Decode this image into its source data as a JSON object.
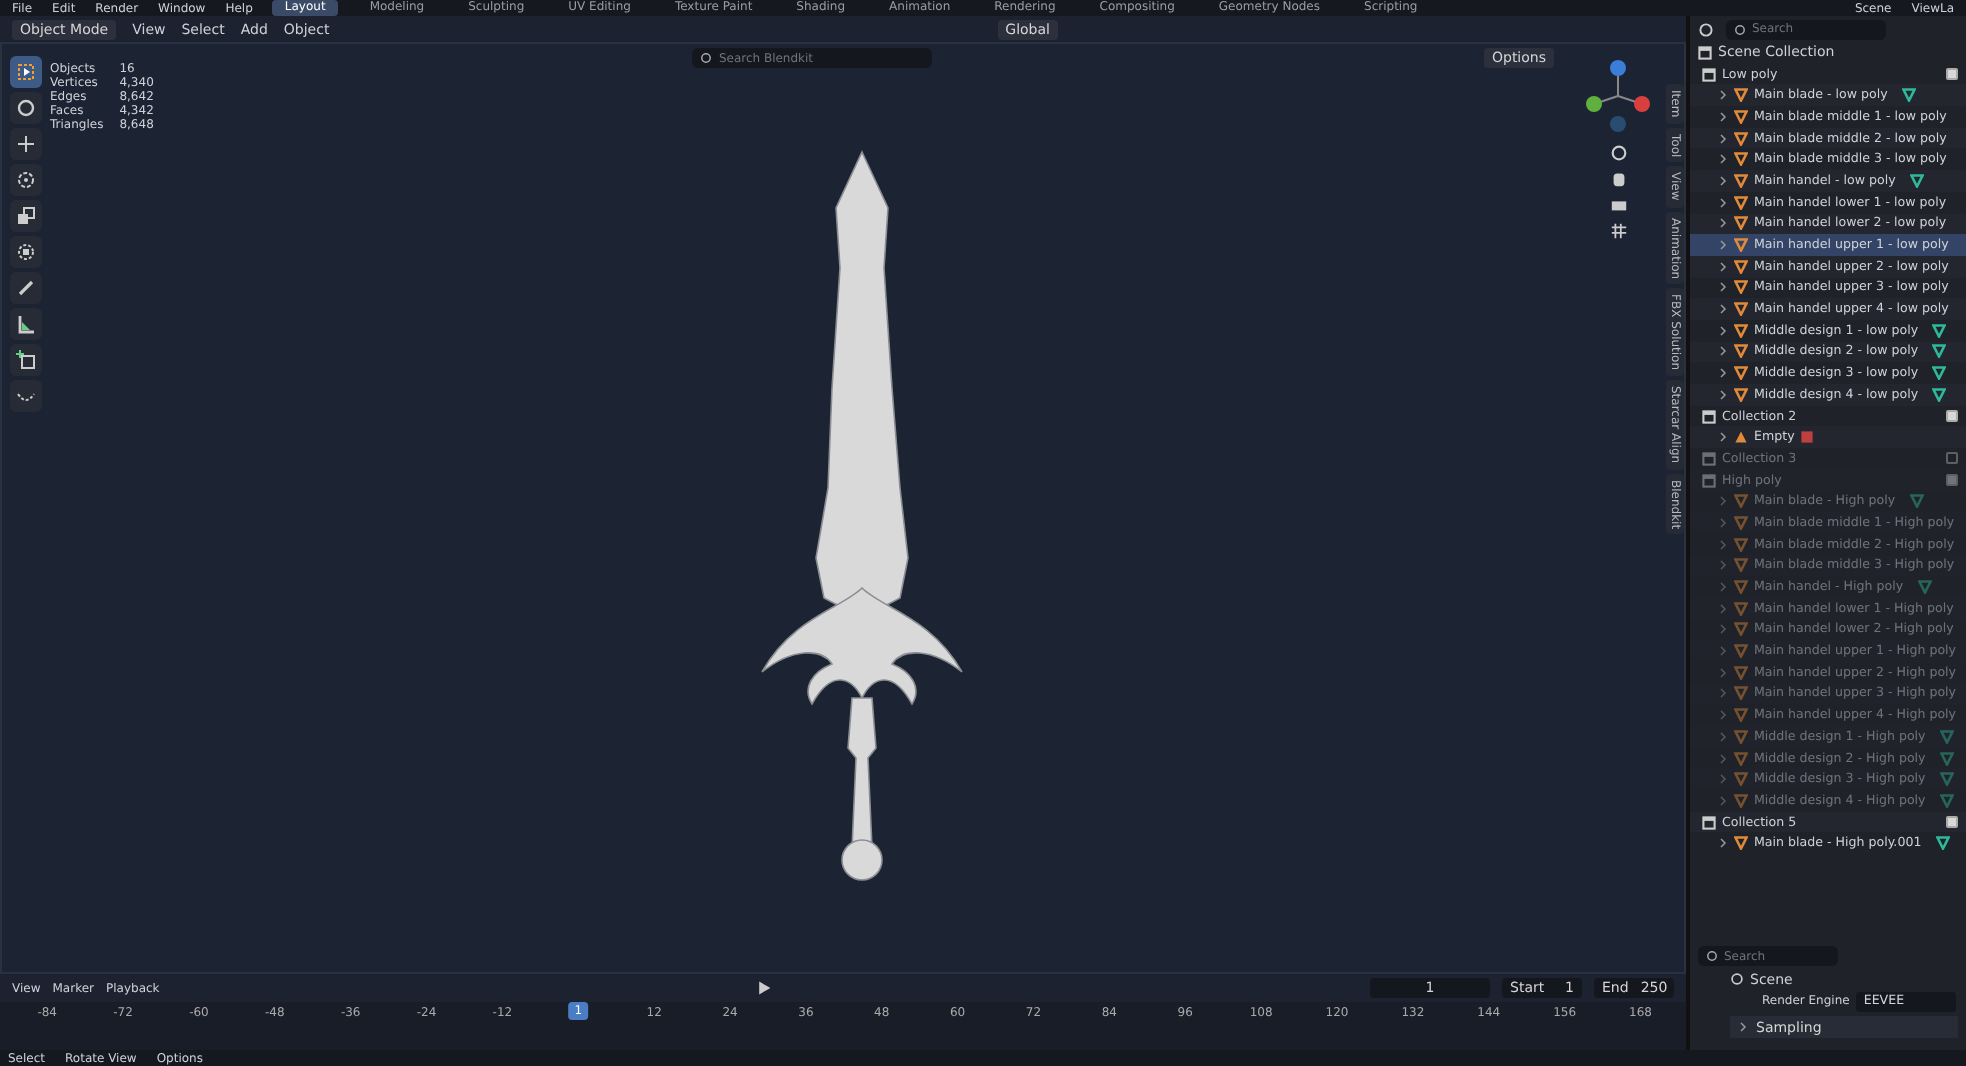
{
  "menu": [
    "File",
    "Edit",
    "Render",
    "Window",
    "Help"
  ],
  "workspaces": [
    {
      "label": "Layout",
      "selected": true
    },
    {
      "label": "Modeling",
      "selected": false
    },
    {
      "label": "Sculpting",
      "selected": false
    },
    {
      "label": "UV Editing",
      "selected": false
    },
    {
      "label": "Texture Paint",
      "selected": false
    },
    {
      "label": "Shading",
      "selected": false
    },
    {
      "label": "Animation",
      "selected": false
    },
    {
      "label": "Rendering",
      "selected": false
    },
    {
      "label": "Compositing",
      "selected": false
    },
    {
      "label": "Geometry Nodes",
      "selected": false
    },
    {
      "label": "Scripting",
      "selected": false
    }
  ],
  "scene": "Scene",
  "view_layer": "ViewLa",
  "header": {
    "mode": "Object Mode",
    "menus": [
      "View",
      "Select",
      "Add",
      "Object"
    ],
    "orientation": "Global"
  },
  "addon_search": {
    "placeholder": "Search Blendkit"
  },
  "options": "Options",
  "stats": [
    {
      "label": "Objects",
      "value": "16"
    },
    {
      "label": "Vertices",
      "value": "4,340"
    },
    {
      "label": "Edges",
      "value": "8,642"
    },
    {
      "label": "Faces",
      "value": "4,342"
    },
    {
      "label": "Triangles",
      "value": "8,648"
    }
  ],
  "tools": [
    {
      "kind": "select",
      "selected": true
    },
    {
      "kind": "cursor",
      "selected": false
    },
    {
      "kind": "move",
      "selected": false
    },
    {
      "kind": "rotate",
      "selected": false
    },
    {
      "kind": "scale",
      "selected": false
    },
    {
      "kind": "transform",
      "selected": false
    },
    {
      "kind": "annotate",
      "selected": false
    },
    {
      "kind": "measure",
      "selected": false
    },
    {
      "kind": "add",
      "selected": false
    },
    {
      "kind": "curve",
      "selected": false
    }
  ],
  "side_tabs": [
    "Item",
    "Tool",
    "View",
    "Animation",
    "FBX Solution",
    "Starcar Align",
    "Blendkit"
  ],
  "outliner": {
    "search": {
      "placeholder": "Search"
    },
    "root": "Scene Collection",
    "collections": [
      {
        "name": "Low poly",
        "dimmed": false,
        "checked": true,
        "children": [
          {
            "name": "Main blade - low poly",
            "kind": "mesh",
            "modifier": true,
            "active": false
          },
          {
            "name": "Main blade middle 1 - low poly",
            "kind": "mesh",
            "modifier": false,
            "active": false
          },
          {
            "name": "Main blade middle 2 - low poly",
            "kind": "mesh",
            "modifier": false,
            "active": false
          },
          {
            "name": "Main blade middle 3 - low poly",
            "kind": "mesh",
            "modifier": false,
            "active": false
          },
          {
            "name": "Main handel - low poly",
            "kind": "mesh",
            "modifier": true,
            "active": false
          },
          {
            "name": "Main handel lower 1 - low poly",
            "kind": "mesh",
            "modifier": false,
            "active": false
          },
          {
            "name": "Main handel lower 2 - low poly",
            "kind": "mesh",
            "modifier": false,
            "active": false
          },
          {
            "name": "Main handel upper 1 - low poly",
            "kind": "mesh",
            "modifier": false,
            "active": true
          },
          {
            "name": "Main handel upper 2 - low poly",
            "kind": "mesh",
            "modifier": false,
            "active": false
          },
          {
            "name": "Main handel upper 3 - low poly",
            "kind": "mesh",
            "modifier": false,
            "active": false
          },
          {
            "name": "Main handel upper 4 - low poly",
            "kind": "mesh",
            "modifier": false,
            "active": false
          },
          {
            "name": "Middle design 1 - low poly",
            "kind": "mesh",
            "modifier": true,
            "active": false
          },
          {
            "name": "Middle design 2 - low poly",
            "kind": "mesh",
            "modifier": true,
            "active": false
          },
          {
            "name": "Middle design 3 - low poly",
            "kind": "mesh",
            "modifier": true,
            "active": false
          },
          {
            "name": "Middle design 4 - low poly",
            "kind": "mesh",
            "modifier": true,
            "active": false
          }
        ]
      },
      {
        "name": "Collection 2",
        "dimmed": false,
        "checked": true,
        "children": [
          {
            "name": "Empty",
            "kind": "empty",
            "modifier": true,
            "active": false
          }
        ]
      },
      {
        "name": "Collection 3",
        "dimmed": true,
        "checked": false
      },
      {
        "name": "High poly",
        "dimmed": true,
        "checked": true,
        "children": [
          {
            "name": "Main blade - High poly",
            "kind": "mesh",
            "modifier": true,
            "active": false
          },
          {
            "name": "Main blade middle 1 - High poly",
            "kind": "mesh",
            "modifier": false,
            "active": false
          },
          {
            "name": "Main blade middle 2 - High poly",
            "kind": "mesh",
            "modifier": false,
            "active": false
          },
          {
            "name": "Main blade middle 3 - High poly",
            "kind": "mesh",
            "modifier": false,
            "active": false
          },
          {
            "name": "Main handel - High poly",
            "kind": "mesh",
            "modifier": true,
            "active": false
          },
          {
            "name": "Main handel lower 1 - High poly",
            "kind": "mesh",
            "modifier": false,
            "active": false
          },
          {
            "name": "Main handel lower 2 - High poly",
            "kind": "mesh",
            "modifier": false,
            "active": false
          },
          {
            "name": "Main handel upper 1 - High poly",
            "kind": "mesh",
            "modifier": false,
            "active": false
          },
          {
            "name": "Main handel upper 2 - High poly",
            "kind": "mesh",
            "modifier": false,
            "active": false
          },
          {
            "name": "Main handel upper 3 - High poly",
            "kind": "mesh",
            "modifier": false,
            "active": false
          },
          {
            "name": "Main handel upper 4 - High poly",
            "kind": "mesh",
            "modifier": false,
            "active": false
          },
          {
            "name": "Middle design 1 - High poly",
            "kind": "mesh",
            "modifier": true,
            "active": false
          },
          {
            "name": "Middle design 2 - High poly",
            "kind": "mesh",
            "modifier": true,
            "active": false
          },
          {
            "name": "Middle design 3 - High poly",
            "kind": "mesh",
            "modifier": true,
            "active": false
          },
          {
            "name": "Middle design 4 - High poly",
            "kind": "mesh",
            "modifier": true,
            "active": false
          }
        ]
      },
      {
        "name": "Collection 5",
        "dimmed": false,
        "checked": true,
        "children": [
          {
            "name": "Main blade - High poly.001",
            "kind": "mesh",
            "modifier": true,
            "active": false
          }
        ]
      }
    ]
  },
  "properties": {
    "search": {
      "placeholder": "Search"
    },
    "scene": "Scene",
    "engine_label": "Render Engine",
    "engine": "EEVEE",
    "panels": [
      "Sampling"
    ]
  },
  "timeline": {
    "menus": [
      "View",
      "Marker",
      "Playback"
    ],
    "frame": "1",
    "start_label": "Start",
    "start": "1",
    "end_label": "End",
    "end": "250",
    "current": "1",
    "ticks": [
      "-84",
      "-72",
      "-60",
      "-48",
      "-36",
      "-24",
      "-12",
      "12",
      "24",
      "36",
      "48",
      "60",
      "72",
      "84",
      "96",
      "108",
      "120",
      "132",
      "144",
      "156",
      "168"
    ]
  },
  "status_bar": [
    "Select",
    "Rotate View",
    "Options"
  ]
}
